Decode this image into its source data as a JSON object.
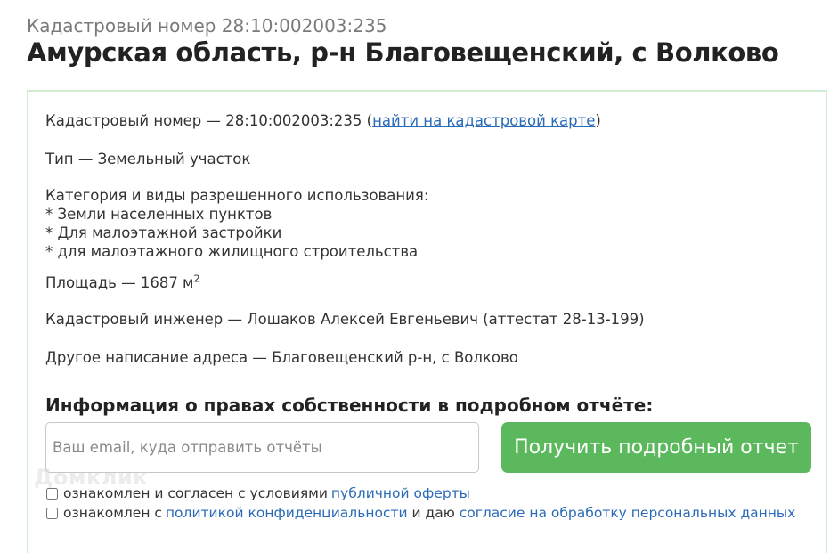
{
  "header": {
    "subtitle": "Кадастровый номер 28:10:002003:235",
    "title": "Амурская область, р-н Благовещенский, с Волково"
  },
  "details": {
    "cadastral_prefix": "Кадастровый номер — 28:10:002003:235 (",
    "cadastral_link": "найти на кадастровой карте",
    "cadastral_suffix": ")",
    "type": "Тип — Земельный участок",
    "category_heading": "Категория и виды разрешенного использования:",
    "category_items": [
      "* Земли населенных пунктов",
      "* Для малоэтажной застройки",
      "* для малоэтажного жилищного строительства"
    ],
    "area": "Площадь — 1687 м",
    "area_unit_power": "2",
    "engineer": "Кадастровый инженер — Лошаков Алексей Евгеньевич (аттестат 28-13-199)",
    "alt_address": "Другое написание адреса — Благовещенский р-н, с Волково"
  },
  "report": {
    "section_title": "Информация о правах собственности в подробном отчёте:",
    "email_placeholder": "Ваш email, куда отправить отчёты",
    "button_label": "Получить подробный отчет",
    "watermark": "Домклик"
  },
  "consent": {
    "offer_text": "ознакомлен и согласен с условиями ",
    "offer_link": "публичной оферты",
    "privacy_text_1": "ознакомлен с ",
    "privacy_link": "политикой конфиденциальности",
    "privacy_text_2": " и даю ",
    "processing_link": "согласие на обработку персональных данных"
  }
}
